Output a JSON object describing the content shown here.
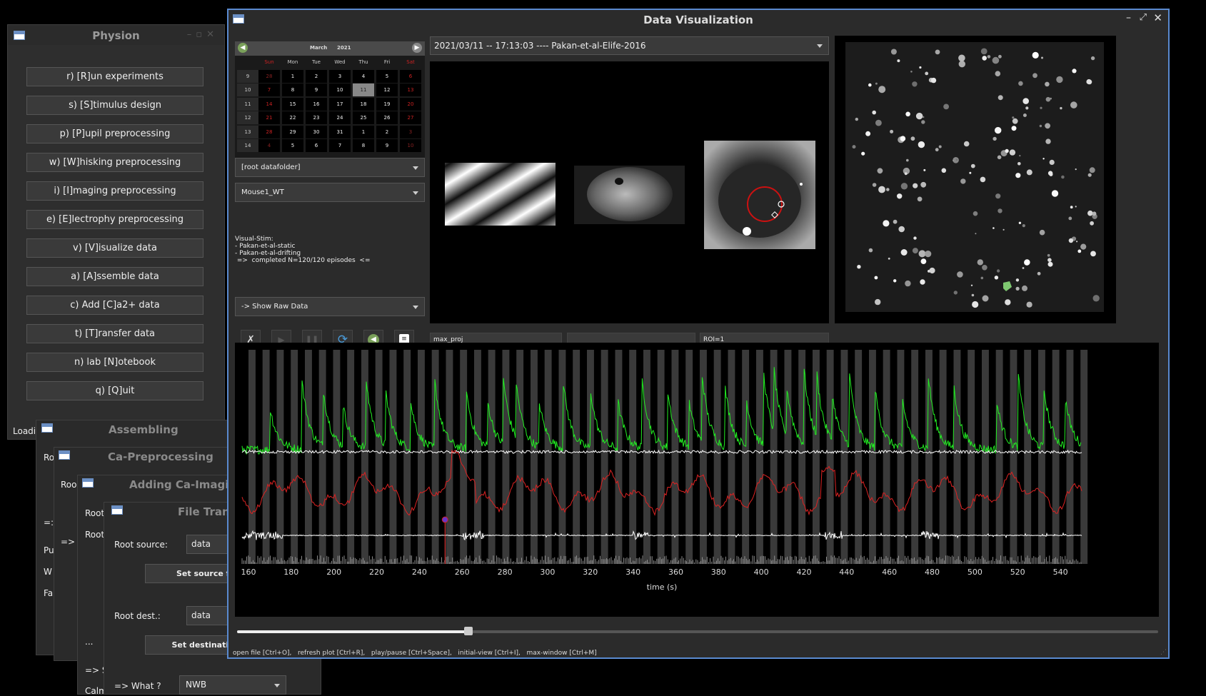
{
  "physion": {
    "title": "Physion",
    "buttons": [
      "r) [R]un experiments",
      "s) [S]timulus design",
      "p) [P]upil preprocessing",
      "w) [W]hisking preprocessing",
      "i) [I]maging preprocessing",
      "e) [E]lectrophy preprocessing",
      "v) [V]isualize data",
      "a) [A]ssemble data",
      "c) Add [C]a2+ data",
      "t) [T]ransfer data",
      "n) lab [N]otebook",
      "q) [Q]uit"
    ],
    "status": "Loadi"
  },
  "assembling": {
    "title": "Assembling",
    "root": "Ro",
    "arrow": "=:",
    "labels": [
      "Pu",
      "W",
      "Fa"
    ]
  },
  "ca_pre": {
    "title": "Ca-Preprocessing",
    "root": "Roo",
    "arrow": "=>"
  },
  "adding": {
    "title": "Adding Ca-Imagi",
    "root1": "Root",
    "root2": "Root",
    "dots": "...",
    "arrow": "=> S",
    "calm": "Calm"
  },
  "transfer": {
    "title": "File Tran",
    "root_source_label": "Root source:",
    "root_source_value": "data",
    "set_source_btn": "Set source fo",
    "root_dest_label": "Root dest.:",
    "root_dest_value": "data",
    "set_dest_btn": "Set destination",
    "what_label": "=> What ?",
    "what_value": "NWB"
  },
  "dv": {
    "title": "Data Visualization",
    "calendar": {
      "month": "March",
      "year": "2021",
      "weekdays": [
        "Sun",
        "Mon",
        "Tue",
        "Wed",
        "Thu",
        "Fri",
        "Sat"
      ],
      "weeks": [
        "9",
        "10",
        "11",
        "12",
        "13",
        "14"
      ],
      "days": [
        [
          "28",
          "1",
          "2",
          "3",
          "4",
          "5",
          "6"
        ],
        [
          "7",
          "8",
          "9",
          "10",
          "11",
          "12",
          "13"
        ],
        [
          "14",
          "15",
          "16",
          "17",
          "18",
          "19",
          "20"
        ],
        [
          "21",
          "22",
          "23",
          "24",
          "25",
          "26",
          "27"
        ],
        [
          "28",
          "29",
          "30",
          "31",
          "1",
          "2",
          "3"
        ],
        [
          "4",
          "5",
          "6",
          "7",
          "8",
          "9",
          "10"
        ]
      ],
      "selected": "11"
    },
    "datafolder": "[root datafolder]",
    "subject": "Mouse1_WT",
    "info_lines": [
      "Visual-Stim:",
      "- Pakan-et-al-static",
      "- Pakan-et-al-drifting",
      " =>  completed N=120/120 episodes  <="
    ],
    "raw_data": "-> Show Raw Data",
    "datafile": "2021/03/11 -- 17:13:03 ---- Pakan-et-al-Elife-2016",
    "fields": {
      "proj": "max_proj",
      "middle": "",
      "roi": "ROI=1"
    },
    "plot": {
      "xlabel": "time (s)",
      "xticks": [
        "160",
        "180",
        "200",
        "220",
        "240",
        "260",
        "280",
        "300",
        "320",
        "340",
        "360",
        "380",
        "400",
        "420",
        "440",
        "460",
        "480",
        "500",
        "520",
        "540"
      ]
    },
    "shortcuts": "open file [Ctrl+O],   refresh plot [Ctrl+R],   play/pause [Ctrl+Space],   initial-view [Ctrl+I],   max-window [Ctrl+M]"
  },
  "colors": {
    "fluo": "#22ee22",
    "pupil": "#dd2222",
    "trace": "#ffffff",
    "cursor": "#ff3333"
  }
}
